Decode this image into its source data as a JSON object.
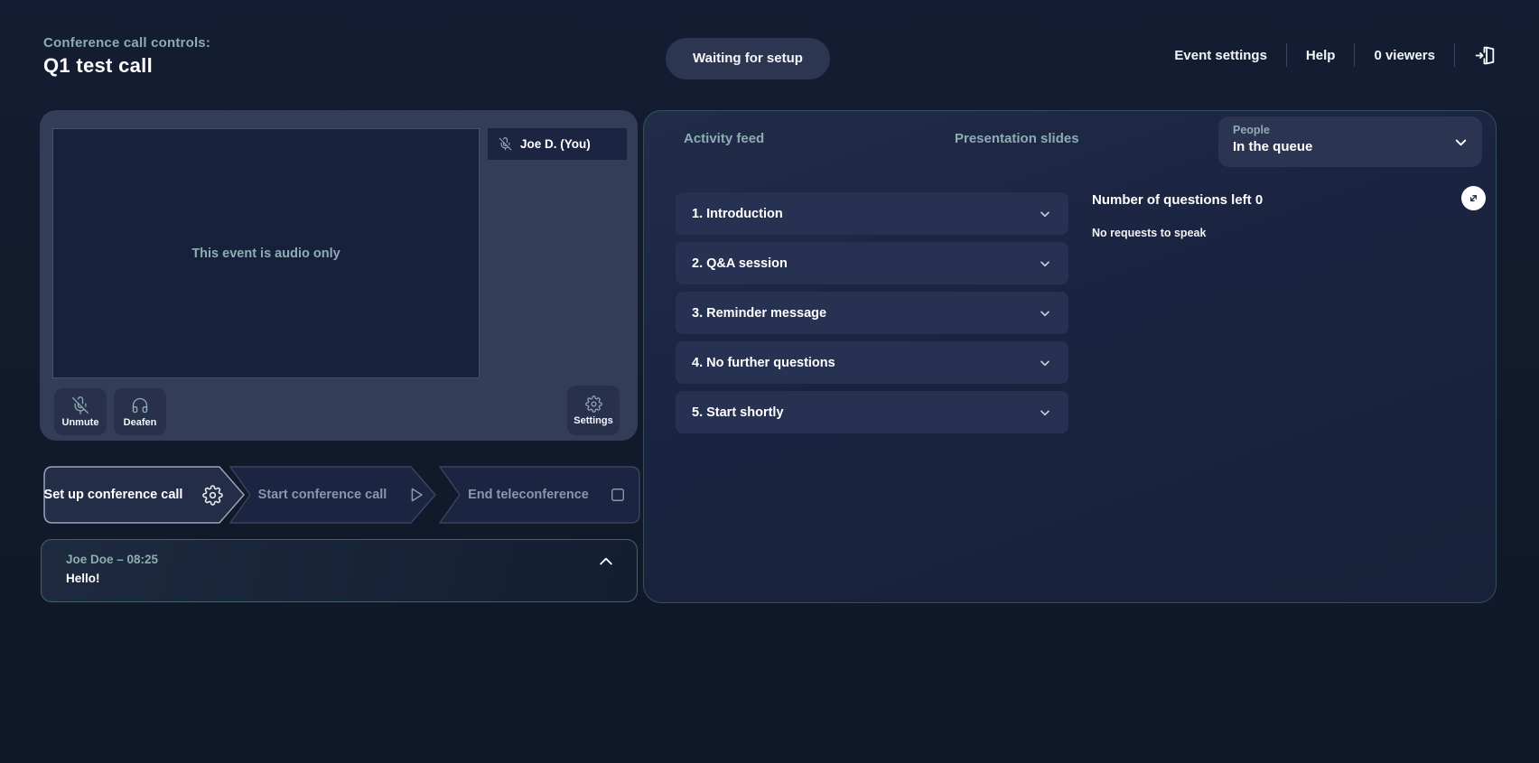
{
  "header": {
    "subtitle": "Conference call controls:",
    "title": "Q1 test call",
    "status_pill": "Waiting for setup",
    "nav": {
      "event_settings": "Event settings",
      "help": "Help",
      "viewers": "0 viewers"
    }
  },
  "stage": {
    "audio_only_message": "This event is audio only",
    "participant_tag": "Joe D. (You)",
    "controls": {
      "unmute": "Unmute",
      "deafen": "Deafen",
      "settings": "Settings"
    }
  },
  "steps": [
    {
      "label": "Set up conference call",
      "icon": "gear-icon",
      "state": "active"
    },
    {
      "label": "Start conference call",
      "icon": "play-icon",
      "state": "inactive"
    },
    {
      "label": "End teleconference",
      "icon": "stop-icon",
      "state": "inactive"
    }
  ],
  "chat": {
    "author_time": "Joe Doe – 08:25",
    "message": "Hello!"
  },
  "panel": {
    "tabs": [
      {
        "label": "Activity feed"
      },
      {
        "label": "Presentation slides"
      }
    ],
    "people_dropdown": {
      "label": "People",
      "selected": "In the queue"
    },
    "agenda": [
      "1. Introduction",
      "2. Q&A session",
      "3. Reminder message",
      "4. No further questions",
      "5. Start shortly"
    ],
    "questions": {
      "counter_label": "Number of questions left 0",
      "empty_state": "No requests to speak"
    }
  },
  "colors": {
    "background": "#111a2c",
    "accent_teal": "#8cadb2",
    "stage_panel": "#333d57",
    "side_panel": "#1a2440",
    "accordion_item": "#273252",
    "pill": "#2c3651",
    "chat_border": "#41646c",
    "text_white": "#f4f6f9",
    "text_muted": "#8b96ac"
  }
}
